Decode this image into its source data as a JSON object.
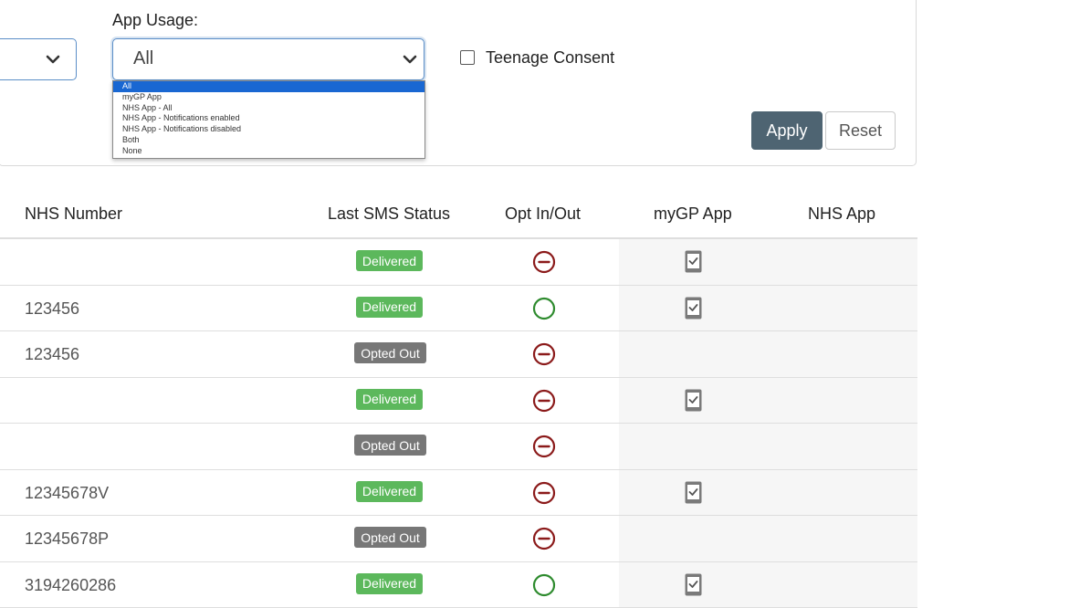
{
  "filters": {
    "app_usage_label": "App Usage:",
    "app_usage_value": "All",
    "app_usage_options": [
      "All",
      "myGP App",
      "NHS App - All",
      "NHS App - Notifications enabled",
      "NHS App - Notifications disabled",
      "Both",
      "None"
    ],
    "teenage_consent_label": "Teenage Consent",
    "apply_label": "Apply",
    "reset_label": "Reset"
  },
  "table": {
    "headers": {
      "nhs_number": "NHS Number",
      "last_sms_status": "Last SMS Status",
      "opt_in_out": "Opt In/Out",
      "mygp_app": "myGP App",
      "nhs_app": "NHS App"
    },
    "rows": [
      {
        "nhs": "",
        "status": "Delivered",
        "opt": "out",
        "mygp": true
      },
      {
        "nhs": "123456",
        "status": "Delivered",
        "opt": "in",
        "mygp": true
      },
      {
        "nhs": "123456",
        "status": "Opted Out",
        "opt": "out",
        "mygp": false
      },
      {
        "nhs": "",
        "status": "Delivered",
        "opt": "out",
        "mygp": true
      },
      {
        "nhs": "",
        "status": "Opted Out",
        "opt": "out",
        "mygp": false
      },
      {
        "nhs": "12345678V",
        "status": "Delivered",
        "opt": "out",
        "mygp": true
      },
      {
        "nhs": "12345678P",
        "status": "Opted Out",
        "opt": "out",
        "mygp": false
      },
      {
        "nhs": "3194260286",
        "status": "Delivered",
        "opt": "in",
        "mygp": true
      }
    ]
  },
  "colors": {
    "delivered": "#5cb85c",
    "opted_out": "#777777",
    "opt_out_icon": "#8b1a1a",
    "opt_in_icon": "#2e8b2e",
    "apply_button": "#4e6472"
  },
  "icons": {
    "opt_out": "minus-circle-icon",
    "opt_in": "circle-icon",
    "app_installed": "phone-check-icon"
  }
}
